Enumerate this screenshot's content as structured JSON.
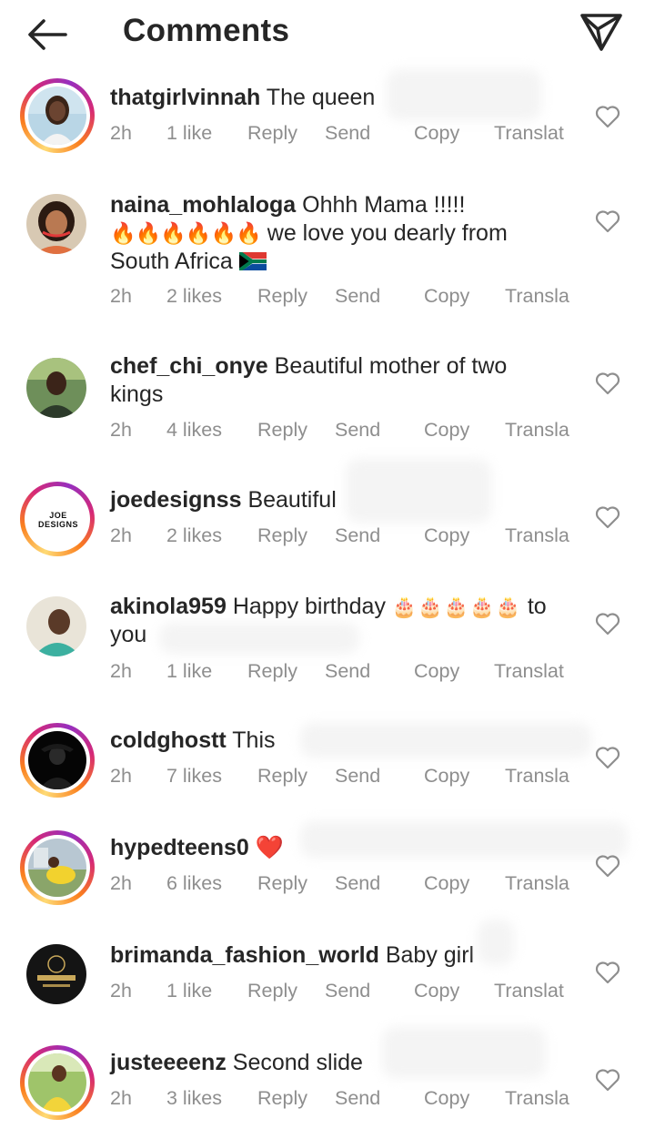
{
  "header": {
    "title": "Comments",
    "back_icon": "arrow-left-icon",
    "send_icon": "paper-plane-icon"
  },
  "colors": {
    "story_ring": [
      "#feda75",
      "#fa7e1e",
      "#d62976",
      "#962fbf"
    ],
    "meta_text": "#8e8e8e",
    "text": "#262626",
    "heart_emoji": "#e0245e"
  },
  "comments": [
    {
      "username": "thatgirlvinnah",
      "text": "The  queen",
      "time": "2h",
      "likes": "1 like",
      "reply": "Reply",
      "send": "Send",
      "copy": "Copy",
      "translate": "Translat",
      "story_ring": true
    },
    {
      "username": "naina_mohlaloga",
      "text": "Ohhh Mama !!!!!",
      "text_line2": "we love you dearly from",
      "text_line3": "South Africa",
      "emojis": "🔥🔥🔥🔥🔥🔥",
      "flag": "south-africa-flag-icon",
      "time": "2h",
      "likes": "2 likes",
      "reply": "Reply",
      "send": "Send",
      "copy": "Copy",
      "translate": "Transla",
      "story_ring": false
    },
    {
      "username": "chef_chi_onye",
      "text": "Beautiful mother of two",
      "text_line2": "kings",
      "time": "2h",
      "likes": "4 likes",
      "reply": "Reply",
      "send": "Send",
      "copy": "Copy",
      "translate": "Transla",
      "story_ring": false
    },
    {
      "username": "joedesignss",
      "text": "Beautiful",
      "logo_line1": "JOE",
      "logo_line2": "DESIGNS",
      "time": "2h",
      "likes": "2 likes",
      "reply": "Reply",
      "send": "Send",
      "copy": "Copy",
      "translate": "Transla",
      "story_ring": true
    },
    {
      "username": "akinola959",
      "text": "Happy birthday",
      "emojis": "🎂🎂🎂🎂🎂",
      "text_after": "to",
      "text_line2": "you",
      "time": "2h",
      "likes": "1 like",
      "reply": "Reply",
      "send": "Send",
      "copy": "Copy",
      "translate": "Translat",
      "story_ring": false
    },
    {
      "username": "coldghostt",
      "text": "This",
      "time": "2h",
      "likes": "7 likes",
      "reply": "Reply",
      "send": "Send",
      "copy": "Copy",
      "translate": "Transla",
      "story_ring": true
    },
    {
      "username": "hypedteens0",
      "text": "❤️",
      "time": "2h",
      "likes": "6 likes",
      "reply": "Reply",
      "send": "Send",
      "copy": "Copy",
      "translate": "Transla",
      "story_ring": true
    },
    {
      "username": "brimanda_fashion_world",
      "text": "Baby girl",
      "time": "2h",
      "likes": "1 like",
      "reply": "Reply",
      "send": "Send",
      "copy": "Copy",
      "translate": "Translat",
      "story_ring": false
    },
    {
      "username": "justeeeenz",
      "text": "Second slide",
      "time": "2h",
      "likes": "3 likes",
      "reply": "Reply",
      "send": "Send",
      "copy": "Copy",
      "translate": "Transla",
      "story_ring": true
    }
  ]
}
